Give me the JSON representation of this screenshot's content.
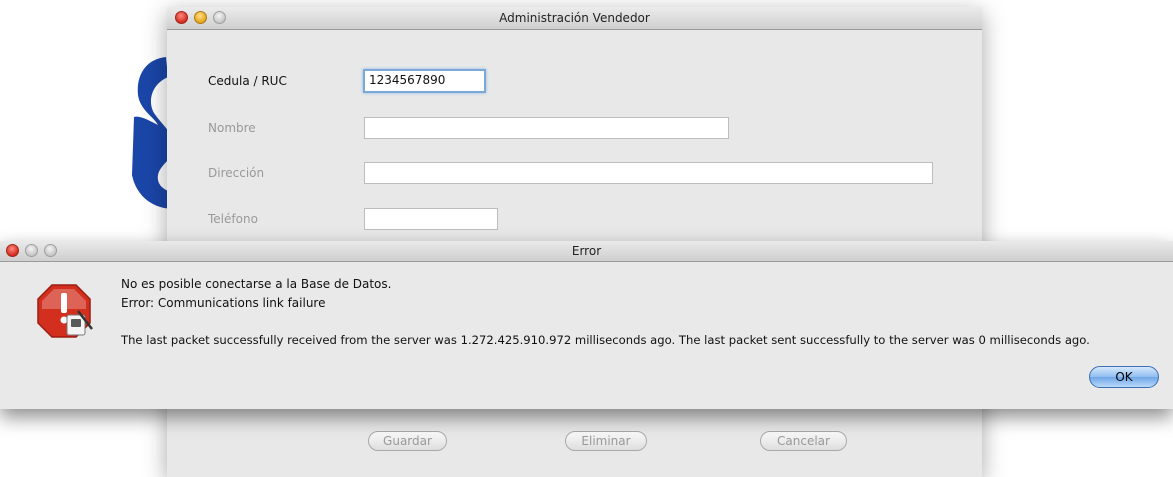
{
  "main_window": {
    "title": "Administración Vendedor",
    "fields": {
      "cedula": {
        "label": "Cedula / RUC",
        "value": "1234567890"
      },
      "nombre": {
        "label": "Nombre",
        "value": ""
      },
      "direccion": {
        "label": "Dirección",
        "value": ""
      },
      "telefono": {
        "label": "Teléfono",
        "value": ""
      }
    },
    "buttons": {
      "guardar": "Guardar",
      "eliminar": "Eliminar",
      "cancelar": "Cancelar"
    }
  },
  "error_dialog": {
    "title": "Error",
    "icon": "warning-icon",
    "line1": "No es posible conectarse a la Base de Datos.",
    "line2": "Error: Communications link failure",
    "line3": "The last packet successfully received from the server was 1.272.425.910.972 milliseconds ago.  The last packet sent successfully to the server was 0 milliseconds ago.",
    "ok_label": "OK"
  },
  "colors": {
    "ok_button": "#6fa6e8",
    "traffic_red": "#d52b1e",
    "traffic_yellow": "#e5a31b",
    "error_icon_red": "#d32f1f",
    "background_logo": "#1a46a8"
  }
}
